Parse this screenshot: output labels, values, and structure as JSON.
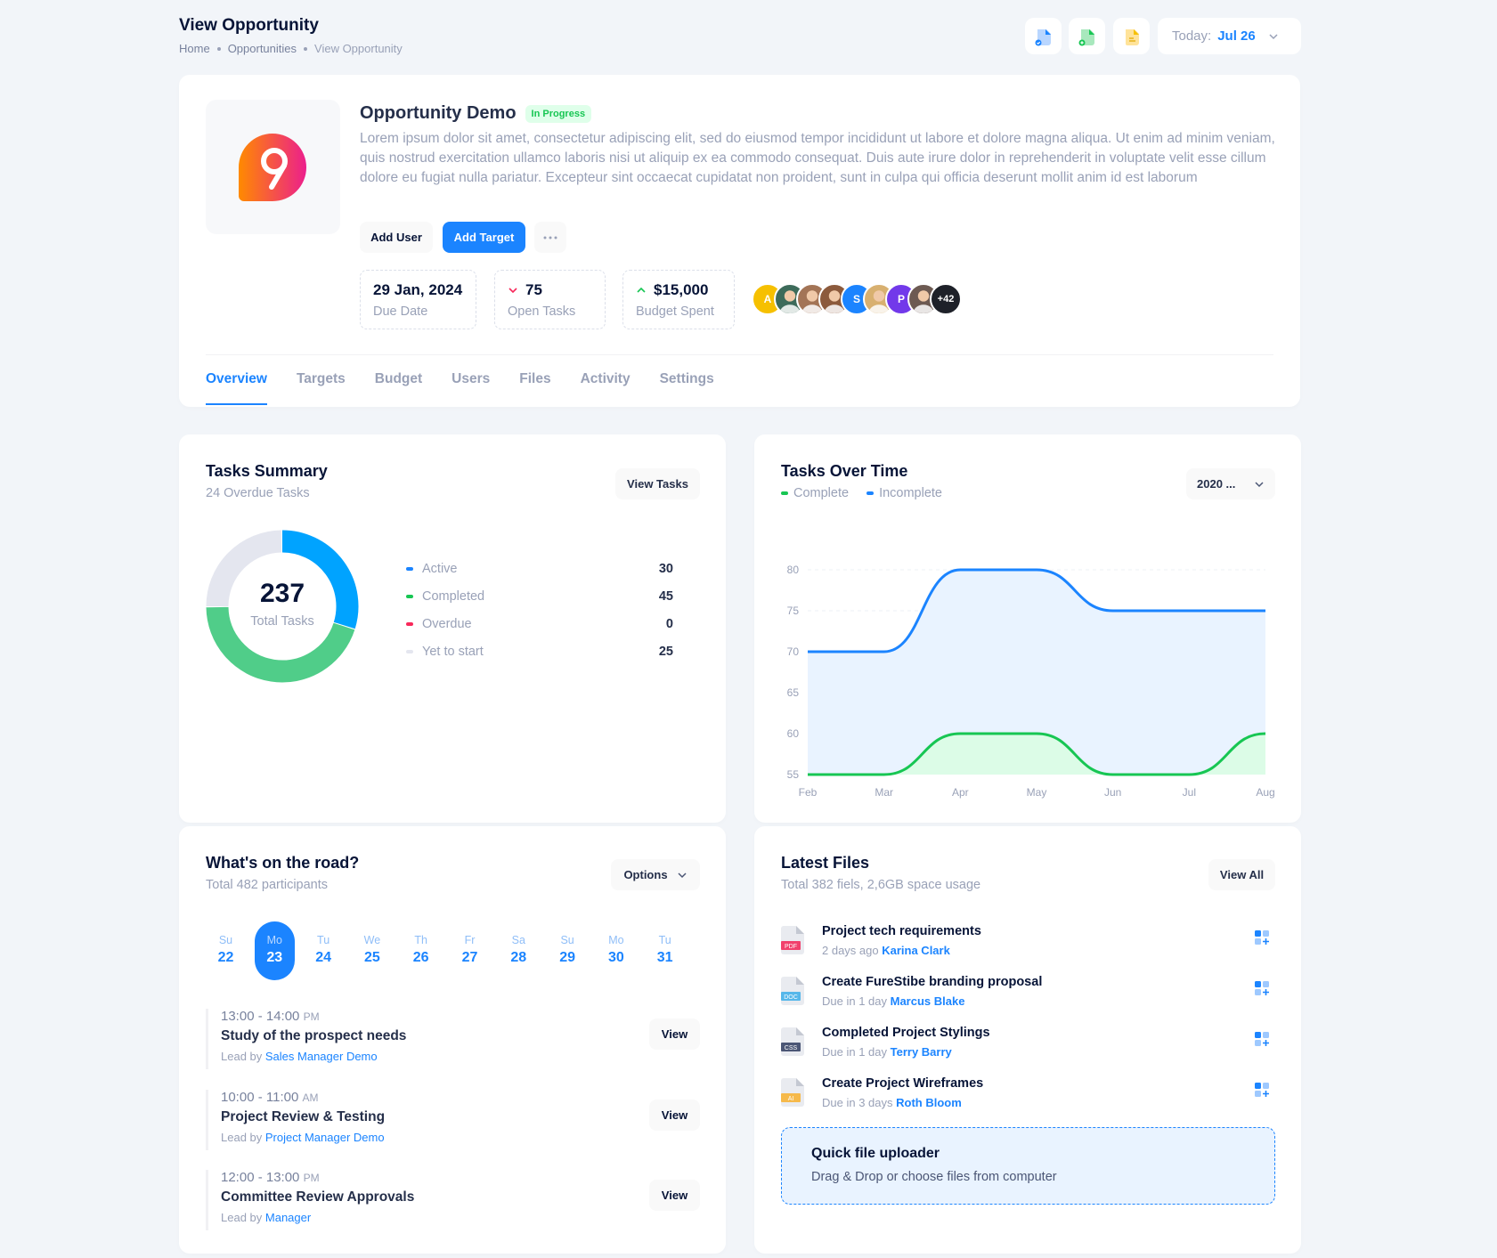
{
  "header": {
    "title": "View Opportunity",
    "breadcrumb": [
      "Home",
      "Opportunities",
      "View Opportunity"
    ],
    "toolbar_icons": [
      "file-check-icon",
      "file-add-icon",
      "file-note-icon"
    ],
    "date_label": "Today:",
    "date_value": "Jul 26"
  },
  "opportunity": {
    "name": "Opportunity Demo",
    "status": "In Progress",
    "logo_char": "9",
    "description": "Lorem ipsum dolor sit amet, consectetur adipiscing elit, sed do eiusmod tempor incididunt ut labore et dolore magna aliqua. Ut enim ad minim veniam, quis nostrud exercitation ullamco laboris nisi ut aliquip ex ea commodo consequat. Duis aute irure dolor in reprehenderit in voluptate velit esse cillum dolore eu fugiat nulla pariatur. Excepteur sint occaecat cupidatat non proident, sunt in culpa qui officia deserunt mollit anim id est laborum",
    "buttons": {
      "add_user": "Add User",
      "add_target": "Add Target",
      "more": "···"
    },
    "stats": [
      {
        "value": "29 Jan, 2024",
        "label": "Due Date",
        "trend": "none"
      },
      {
        "value": "75",
        "label": "Open Tasks",
        "trend": "down"
      },
      {
        "value": "$15,000",
        "label": "Budget Spent",
        "trend": "up"
      }
    ],
    "avatars": [
      {
        "type": "initial",
        "text": "A",
        "color": "#f6c000"
      },
      {
        "type": "photo",
        "color": "#3d6b5a"
      },
      {
        "type": "photo",
        "color": "#a37456"
      },
      {
        "type": "photo",
        "color": "#8c5a3c"
      },
      {
        "type": "initial",
        "text": "S",
        "color": "#1b84ff"
      },
      {
        "type": "photo",
        "color": "#d8b070"
      },
      {
        "type": "initial",
        "text": "P",
        "color": "#7239ea"
      },
      {
        "type": "photo",
        "color": "#6d5a52"
      },
      {
        "type": "count",
        "text": "+42",
        "color": "#1e2129"
      }
    ],
    "tabs": [
      "Overview",
      "Targets",
      "Budget",
      "Users",
      "Files",
      "Activity",
      "Settings"
    ],
    "active_tab": 0
  },
  "tasks_summary": {
    "title": "Tasks Summary",
    "subtitle": "24 Overdue Tasks",
    "button": "View Tasks",
    "total": "237",
    "total_label": "Total Tasks",
    "items": [
      {
        "label": "Active",
        "value": 30,
        "color": "#1b84ff"
      },
      {
        "label": "Completed",
        "value": 45,
        "color": "#17c653"
      },
      {
        "label": "Overdue",
        "value": 0,
        "color": "#f8285a"
      },
      {
        "label": "Yet to start",
        "value": 25,
        "color": "#e4e6ef"
      }
    ]
  },
  "tasks_over_time": {
    "title": "Tasks Over Time",
    "legend": [
      {
        "label": "Complete",
        "color": "#17c653"
      },
      {
        "label": "Incomplete",
        "color": "#1b84ff"
      }
    ],
    "select_value": "2020 ...",
    "chart_data": {
      "type": "area",
      "title": "Tasks Over Time",
      "x": [
        "Feb",
        "Mar",
        "Apr",
        "May",
        "Jun",
        "Jul",
        "Aug"
      ],
      "series": [
        {
          "name": "Incomplete",
          "values": [
            70,
            70,
            80,
            80,
            75,
            75,
            75
          ],
          "color": "#1b84ff"
        },
        {
          "name": "Complete",
          "values": [
            55,
            55,
            60,
            60,
            55,
            55,
            60
          ],
          "color": "#17c653"
        }
      ],
      "yticks": [
        55,
        60,
        65,
        70,
        75,
        80
      ],
      "ylim": [
        55,
        80
      ],
      "grid": true,
      "legend": "top-left"
    }
  },
  "road": {
    "title": "What's on the road?",
    "subtitle": "Total 482 participants",
    "button": "Options",
    "days": [
      {
        "name": "Su",
        "date": "22"
      },
      {
        "name": "Mo",
        "date": "23"
      },
      {
        "name": "Tu",
        "date": "24"
      },
      {
        "name": "We",
        "date": "25"
      },
      {
        "name": "Th",
        "date": "26"
      },
      {
        "name": "Fr",
        "date": "27"
      },
      {
        "name": "Sa",
        "date": "28"
      },
      {
        "name": "Su",
        "date": "29"
      },
      {
        "name": "Mo",
        "date": "30"
      },
      {
        "name": "Tu",
        "date": "31"
      }
    ],
    "active_day": 1,
    "events": [
      {
        "time": "13:00 - 14:00",
        "period": "PM",
        "name": "Study of the prospect needs",
        "lead_label": "Lead by",
        "lead": "Sales Manager Demo",
        "button": "View"
      },
      {
        "time": "10:00 - 11:00",
        "period": "AM",
        "name": "Project Review & Testing",
        "lead_label": "Lead by",
        "lead": "Project Manager Demo",
        "button": "View"
      },
      {
        "time": "12:00 - 13:00",
        "period": "PM",
        "name": "Committee Review Approvals",
        "lead_label": "Lead by",
        "lead": "Manager",
        "button": "View"
      }
    ]
  },
  "files": {
    "title": "Latest Files",
    "subtitle": "Total 382 fiels, 2,6GB space usage",
    "button": "View All",
    "items": [
      {
        "type": "PDF",
        "type_color": "#f1416c",
        "name": "Project tech requirements",
        "meta": "2 days ago",
        "person": "Karina Clark"
      },
      {
        "type": "DOC",
        "type_color": "#56b7ea",
        "name": "Create FureStibe branding proposal",
        "meta": "Due in 1 day",
        "person": "Marcus Blake"
      },
      {
        "type": "CSS",
        "type_color": "#4b5675",
        "name": "Completed Project Stylings",
        "meta": "Due in 1 day",
        "person": "Terry Barry"
      },
      {
        "type": "AI",
        "type_color": "#f6b94a",
        "name": "Create Project Wireframes",
        "meta": "Due in 3 days",
        "person": "Roth Bloom"
      }
    ],
    "uploader": {
      "title": "Quick file uploader",
      "subtitle": "Drag & Drop or choose files from computer"
    }
  }
}
